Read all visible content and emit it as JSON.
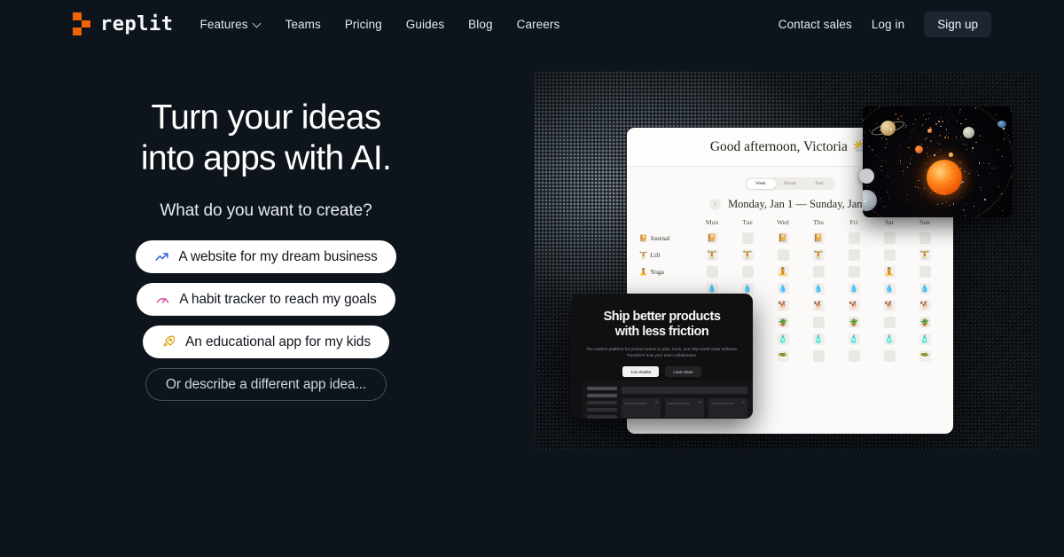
{
  "brand": {
    "name": "replit",
    "logo_color": "#F26207"
  },
  "nav": {
    "links": [
      {
        "label": "Features",
        "has_dropdown": true
      },
      {
        "label": "Teams",
        "has_dropdown": false
      },
      {
        "label": "Pricing",
        "has_dropdown": false
      },
      {
        "label": "Guides",
        "has_dropdown": false
      },
      {
        "label": "Blog",
        "has_dropdown": false
      },
      {
        "label": "Careers",
        "has_dropdown": false
      }
    ],
    "contact_sales": "Contact sales",
    "log_in": "Log in",
    "sign_up": "Sign up"
  },
  "hero": {
    "headline_line1": "Turn your ideas",
    "headline_line2": "into apps with AI.",
    "subhead": "What do you want to create?",
    "pills": [
      {
        "label": "A website for my dream business",
        "icon": "trending-up-icon",
        "icon_color": "#2f62d8",
        "style": "solid"
      },
      {
        "label": "A habit tracker to reach my goals",
        "icon": "gauge-icon",
        "icon_color": "#d4499b",
        "style": "solid"
      },
      {
        "label": "An educational app for my kids",
        "icon": "rocket-icon",
        "icon_color": "#d9a514",
        "style": "solid"
      },
      {
        "label": "Or describe a different app idea...",
        "icon": "",
        "icon_color": "",
        "style": "outline"
      }
    ]
  },
  "collage": {
    "habit_app": {
      "greeting": "Good afternoon, Victoria",
      "greeting_emoji": "⛅",
      "segments": [
        "Week",
        "Month",
        "Year"
      ],
      "active_segment": "Week",
      "prev_arrow": "‹",
      "date_range": "Monday, Jan 1 — Sunday, Jan 7",
      "day_headers": [
        "Mon",
        "Tue",
        "Wed",
        "Thu",
        "Fri",
        "Sat",
        "Sun"
      ],
      "habits": [
        {
          "name": "Journal",
          "emoji": "📔",
          "days": [
            1,
            0,
            1,
            1,
            0,
            0,
            0
          ]
        },
        {
          "name": "Lift",
          "emoji": "🏋️",
          "days": [
            1,
            1,
            0,
            1,
            0,
            0,
            1
          ]
        },
        {
          "name": "Yoga",
          "emoji": "🧘",
          "days": [
            0,
            0,
            1,
            0,
            0,
            1,
            0
          ]
        },
        {
          "name": "",
          "emoji": "💧",
          "days": [
            1,
            1,
            1,
            1,
            1,
            1,
            1
          ]
        },
        {
          "name": "",
          "emoji": "🐕",
          "days": [
            1,
            1,
            1,
            1,
            1,
            1,
            1
          ]
        },
        {
          "name": "",
          "emoji": "🪴",
          "days": [
            1,
            0,
            1,
            0,
            1,
            0,
            1
          ]
        },
        {
          "name": "",
          "emoji": "🧴",
          "days": [
            1,
            1,
            1,
            1,
            1,
            1,
            1
          ]
        },
        {
          "name": "",
          "emoji": "🥗",
          "days": [
            0,
            1,
            1,
            0,
            0,
            0,
            1
          ]
        }
      ]
    },
    "product_card": {
      "title_line1": "Ship better products",
      "title_line2": "with less friction",
      "body": "The modern platform for product teams to plan, track, and ship world-class software. Transform how your team collaborates.",
      "primary_button": "Join Waitlist",
      "secondary_button": "Learn More"
    },
    "space_card": {
      "name": "solar-system-illustration"
    }
  }
}
